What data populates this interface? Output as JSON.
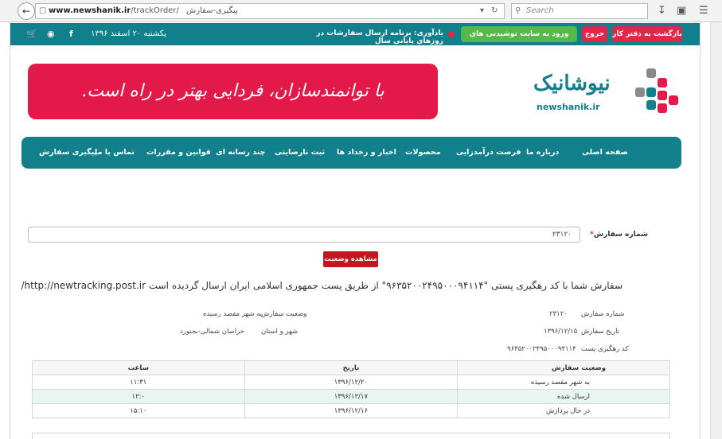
{
  "browser": {
    "url_domain": "www.newshanik.ir",
    "url_path": "/trackOrder/",
    "tab_title": "پیگیری-سفارش",
    "search_placeholder": "Search",
    "back_icon": "arrow-left-icon",
    "refresh_icon": "refresh-icon"
  },
  "topbar": {
    "back_office": "بازگشت به دفتر کار",
    "logout": "خروج",
    "enter_site": "ورود به سایت نوشیدنی های نیوشا",
    "reminder": "یادآوری: برنامه ارسال سفارشات در روزهای پایانی سال",
    "date": "یکشنبه ۲۰ اسفند ۱۳۹۶",
    "social": {
      "facebook": "f",
      "instagram": "instagram-icon",
      "cart": "cart-icon"
    },
    "colors": {
      "bar": "#12808c",
      "red": "#e2264a",
      "green": "#55b84a"
    }
  },
  "header": {
    "slogan": "با توانمندسازان، فردایی بهتر در راه است.",
    "logo_word": "نیوشانیک",
    "logo_url": "newshanik.ir"
  },
  "nav": {
    "items": [
      "صفحه اصلی",
      "درباره ما",
      "فرصت درآمدزایی",
      "محصولات",
      "اخبار و رخداد ها",
      "ثبت نارضایتی",
      "چند رسانه ای",
      "قوانین و مقررات",
      "تماس با ما",
      "پیگیری سفارش"
    ]
  },
  "form": {
    "order_label": "شماره سفارش",
    "required_mark": "*",
    "order_value": "۲۳۱۲۰",
    "view_button": "مشاهده وضعیت"
  },
  "result": {
    "message": "سفارش شما با کد رهگیری پستی \"۹۶۳۵۲۰۰۲۴۹۵۰۰۰۹۴۱۱۴\" از طریق پست جمهوری اسلامی ایران ارسال گردیده است http://newtracking.post.ir/",
    "order_number_label": "شماره سفارش",
    "order_number": "۲۳۱۲۰",
    "order_status_label": "وضعیت سفارش",
    "order_status": "به شهر مقصد رسیده",
    "order_date_label": "تاریخ سفارش",
    "order_date": "۱۳۹۶/۱۲/۱۵",
    "city_label": "شهر و استان",
    "city": "خراسان شمالی-بجنورد",
    "tracking_label": "کد رهگیری پست",
    "tracking_code": "۹۶۳۵۲۰۰۲۴۹۵۰۰۰۹۴۱۱۴"
  },
  "table": {
    "headers": [
      "وضعیت سفارش",
      "تاریخ",
      "ساعت"
    ],
    "rows": [
      [
        "به شهر مقصد رسیده",
        "۱۳۹۶/۱۲/۲۰",
        "۱۱:۳۱"
      ],
      [
        "ارسال شده",
        "۱۳۹۶/۱۲/۱۷",
        "۱۲:۰"
      ],
      [
        "در حال پردازش",
        "۱۳۹۶/۱۲/۱۶",
        "۱۵:۱۰"
      ]
    ]
  }
}
